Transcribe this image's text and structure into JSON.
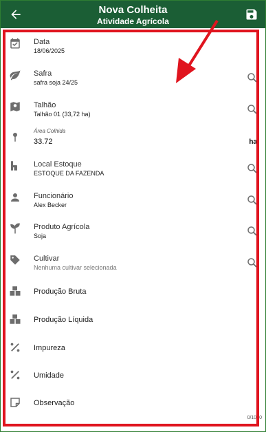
{
  "header": {
    "title": "Nova Colheita",
    "subtitle": "Atividade Agrícola",
    "back_icon": "arrow-left-icon",
    "save_icon": "floppy-disk-icon"
  },
  "colors": {
    "header_bg": "#1b5e35",
    "highlight": "#e0141e",
    "icon": "#6d6d6d"
  },
  "fields": {
    "data": {
      "label": "Data",
      "value": "18/06/2025"
    },
    "safra": {
      "label": "Safra",
      "value": "safra soja 24/25"
    },
    "talhao": {
      "label": "Talhão",
      "value": "Talhão 01 (33,72 ha)"
    },
    "area": {
      "label": "Área Colhida",
      "value": "33.72",
      "unit": "ha"
    },
    "local": {
      "label": "Local Estoque",
      "value": "ESTOQUE DA FAZENDA"
    },
    "funcionario": {
      "label": "Funcionário",
      "value": "Alex Becker"
    },
    "produto": {
      "label": "Produto Agrícola",
      "value": "Soja"
    },
    "cultivar": {
      "label": "Cultivar",
      "value": "Nenhuma cultivar selecionada"
    },
    "producao_bruta": {
      "label": "Produção Bruta"
    },
    "producao_liquida": {
      "label": "Produção Líquida"
    },
    "impureza": {
      "label": "Impureza"
    },
    "umidade": {
      "label": "Umidade"
    },
    "observacao": {
      "label": "Observação",
      "counter": "0/1000"
    }
  }
}
